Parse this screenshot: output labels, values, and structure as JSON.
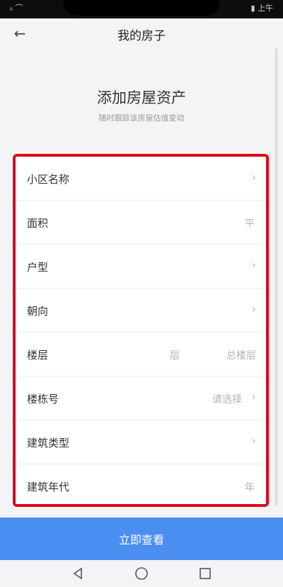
{
  "status_bar": {
    "left_text": "ᵢᵢ  ⌒",
    "right_text": "▮ 上午"
  },
  "nav": {
    "title": "我的房子",
    "back_glyph": "←"
  },
  "header": {
    "title": "添加房屋资产",
    "subtitle": "随时跟踪该房屋估值变动"
  },
  "form": {
    "rows": [
      {
        "label": "小区名称",
        "value": "",
        "unit": "",
        "chevron": "›"
      },
      {
        "label": "面积",
        "value": "",
        "unit": "平",
        "chevron": ""
      },
      {
        "label": "户型",
        "value": "",
        "unit": "",
        "chevron": "›"
      },
      {
        "label": "朝向",
        "value": "",
        "unit": "",
        "chevron": "›"
      },
      {
        "label": "楼层",
        "value": "层",
        "unit": "总楼层",
        "chevron": ""
      },
      {
        "label": "楼栋号",
        "value": "请选择",
        "unit": "",
        "chevron": "›"
      },
      {
        "label": "建筑类型",
        "value": "",
        "unit": "",
        "chevron": "›"
      },
      {
        "label": "建筑年代",
        "value": "",
        "unit": "年",
        "chevron": ""
      }
    ]
  },
  "actions": {
    "submit_label": "立即查看"
  },
  "colors": {
    "highlight_border": "#d9091d",
    "primary_button": "#4a8ef1",
    "background": "#f4f4f6"
  }
}
